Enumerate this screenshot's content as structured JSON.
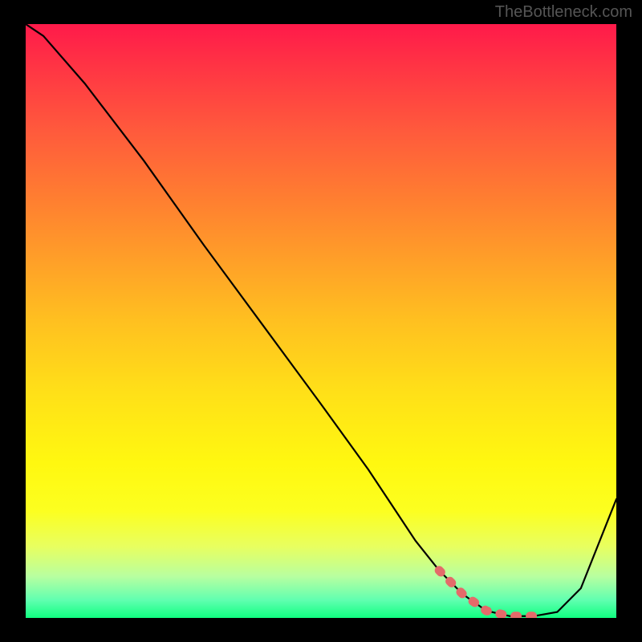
{
  "watermark": "TheBottleneck.com",
  "chart_data": {
    "type": "line",
    "title": "",
    "xlabel": "",
    "ylabel": "",
    "xlim": [
      0,
      100
    ],
    "ylim": [
      0,
      100
    ],
    "series": [
      {
        "name": "bottleneck-curve",
        "x": [
          0,
          3,
          10,
          20,
          30,
          40,
          50,
          58,
          62,
          66,
          70,
          74,
          78,
          82,
          86,
          90,
          94,
          100
        ],
        "values": [
          100,
          98,
          90,
          77,
          63,
          49.5,
          36,
          25,
          19,
          13,
          8,
          4,
          1.2,
          0.3,
          0.3,
          1,
          5,
          20
        ]
      },
      {
        "name": "optimal-highlight",
        "x": [
          70,
          74,
          78,
          82,
          86
        ],
        "values": [
          8,
          4,
          1.2,
          0.3,
          0.3
        ]
      }
    ],
    "note": "Values are percentage estimates read from the plotted curve; x is normalized 0-100 left-to-right, values represent curve height 0-100 bottom-to-top."
  }
}
